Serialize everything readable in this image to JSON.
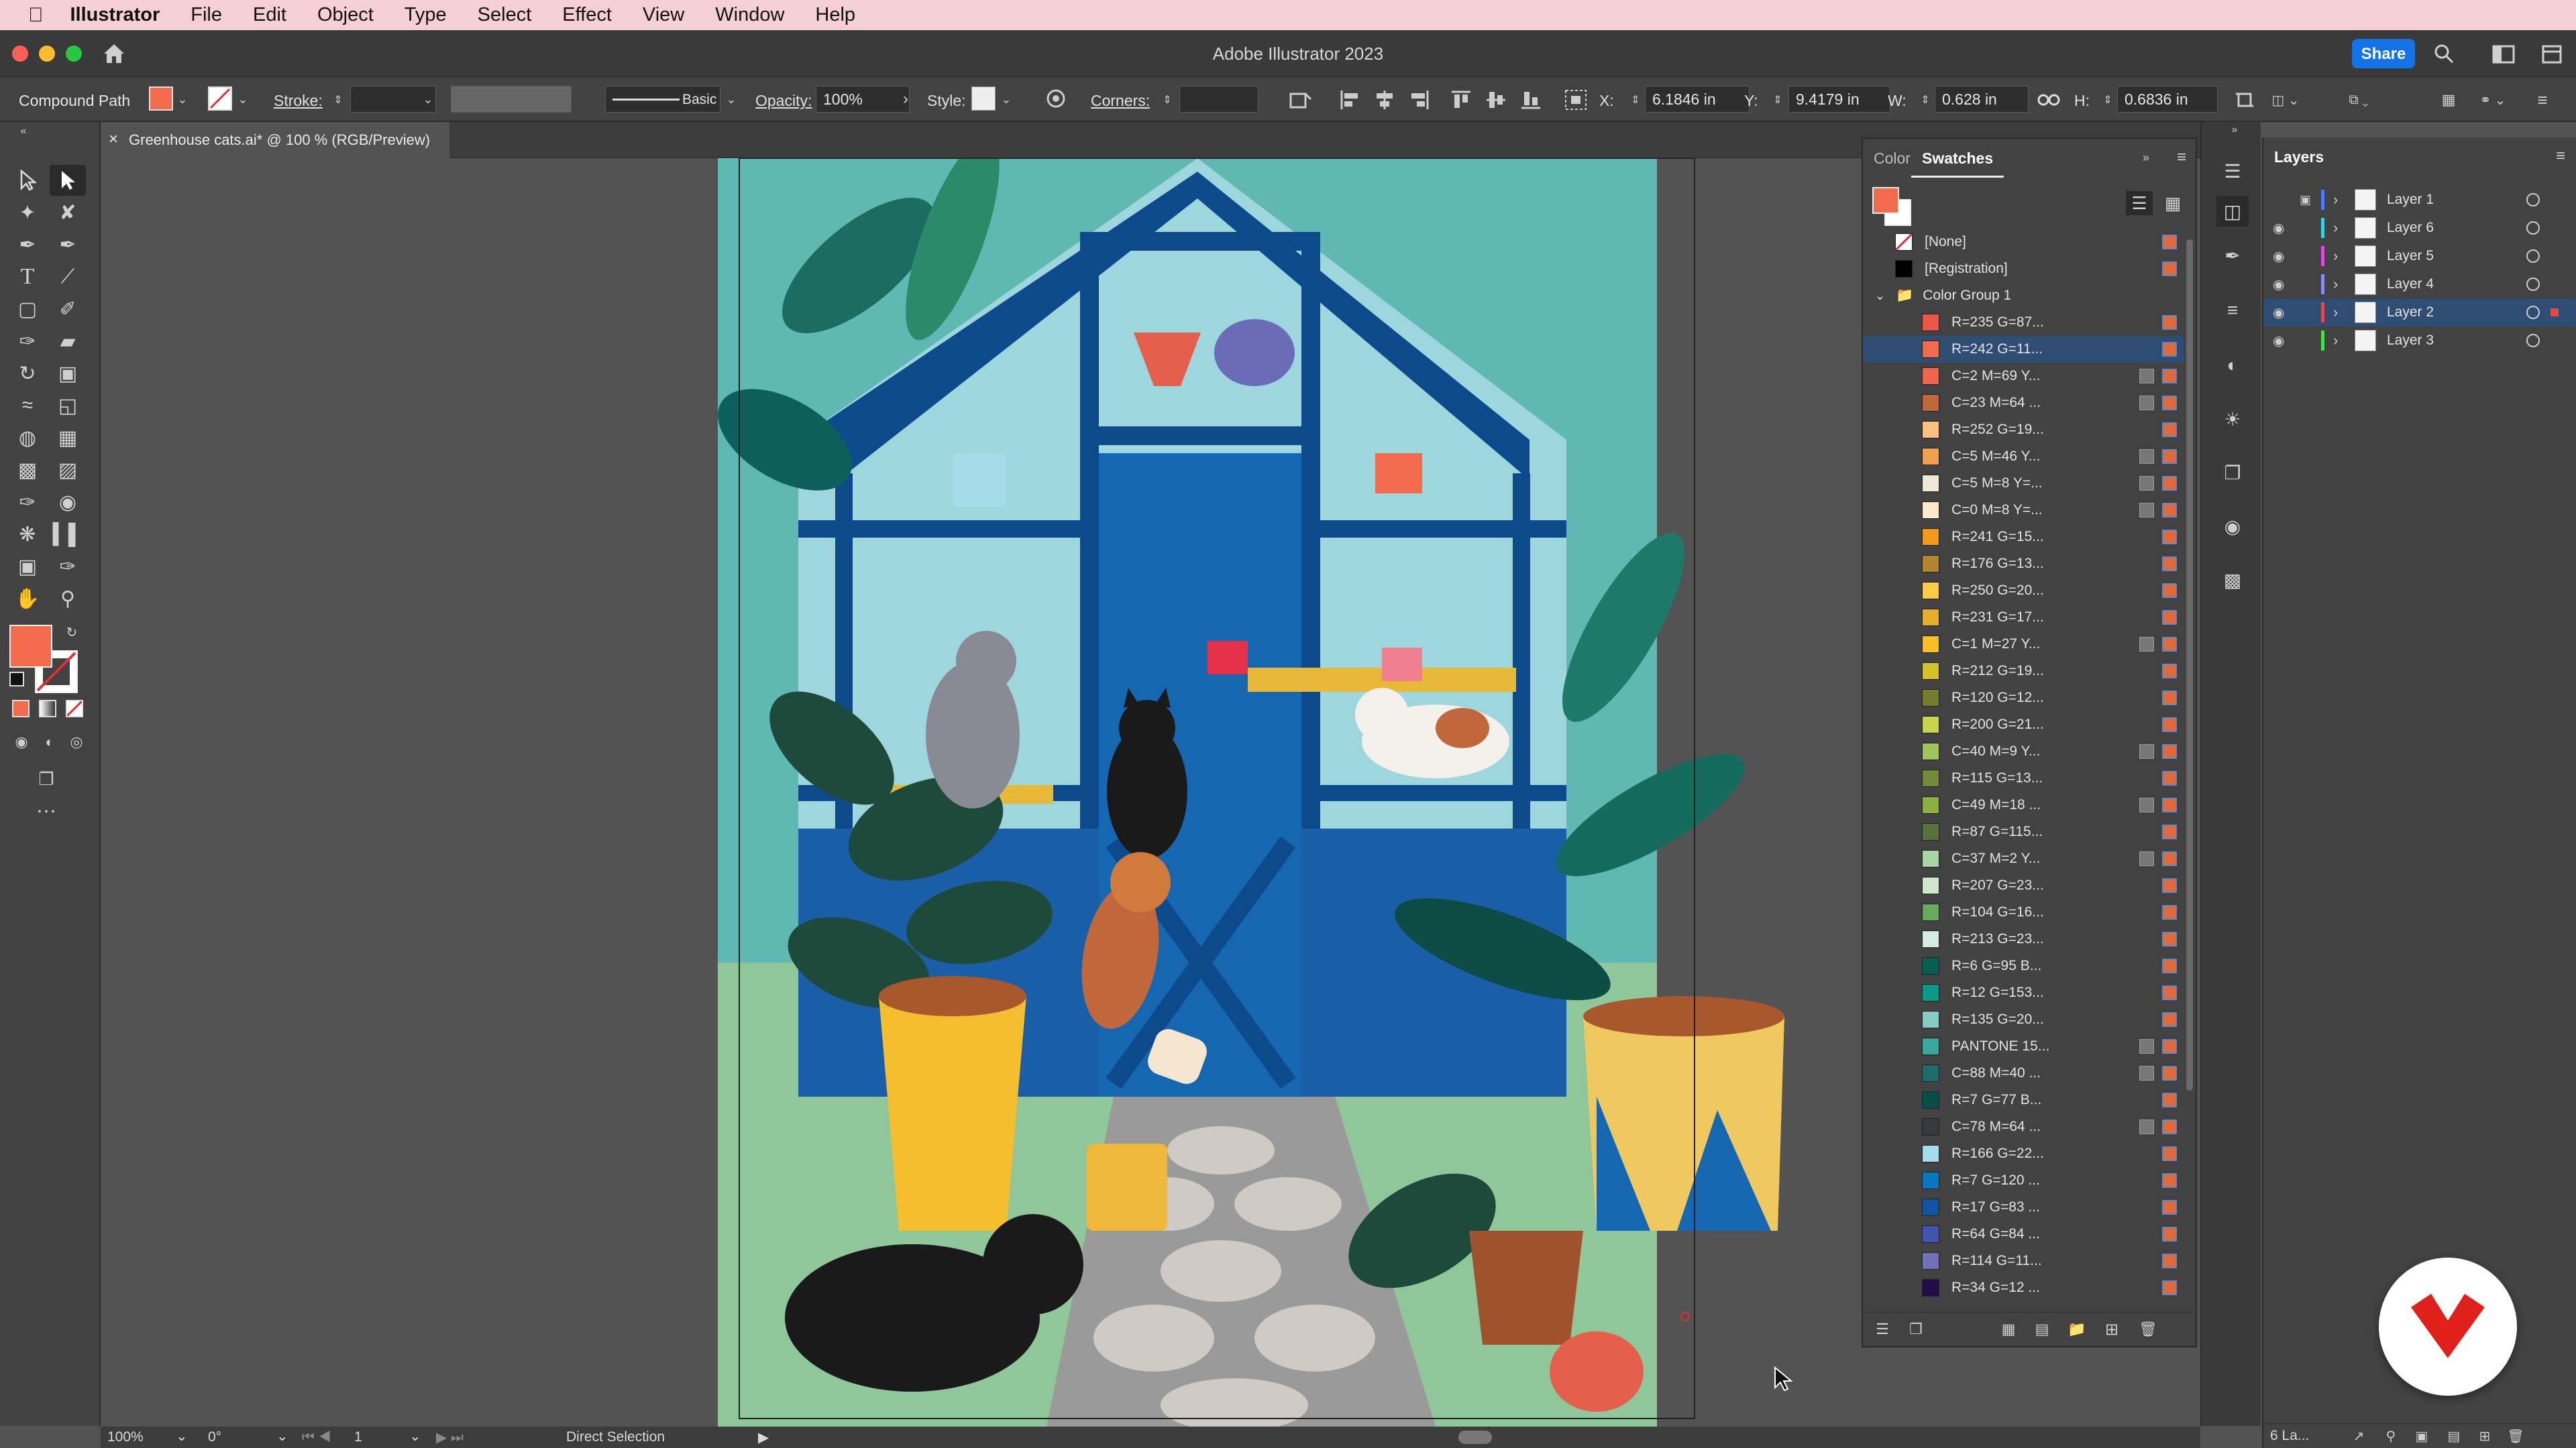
{
  "menubar": {
    "app_name": "Illustrator",
    "items": [
      "File",
      "Edit",
      "Object",
      "Type",
      "Select",
      "Effect",
      "View",
      "Window",
      "Help"
    ]
  },
  "titlebar": {
    "title": "Adobe Illustrator 2023",
    "share_label": "Share"
  },
  "control_bar": {
    "selection_type": "Compound Path",
    "stroke_label": "Stroke:",
    "brush_label": "Basic",
    "opacity_label": "Opacity:",
    "opacity_value": "100%",
    "style_label": "Style:",
    "corners_label": "Corners:",
    "x_label": "X:",
    "x_value": "6.1846 in",
    "y_label": "Y:",
    "y_value": "9.4179 in",
    "w_label": "W:",
    "w_value": "0.628 in",
    "h_label": "H:",
    "h_value": "0.6836 in"
  },
  "document": {
    "tab_title": "Greenhouse cats.ai* @ 100 % (RGB/Preview)"
  },
  "status_bar": {
    "zoom": "100%",
    "rotation": "0°",
    "artboard": "1",
    "tool": "Direct Selection"
  },
  "swatches_panel": {
    "tabs": [
      "Color",
      "Swatches"
    ],
    "active_tab": "Swatches",
    "items": [
      {
        "label": "[None]",
        "color": "none"
      },
      {
        "label": "[Registration]",
        "color": "#000000"
      }
    ],
    "group_label": "Color Group 1",
    "group_items": [
      {
        "label": "R=235 G=87...",
        "color": "#eb574a"
      },
      {
        "label": "R=242 G=11...",
        "color": "#f26b4c",
        "selected": true
      },
      {
        "label": "C=2 M=69 Y...",
        "color": "#f0654b",
        "global": true
      },
      {
        "label": "C=23 M=64 ...",
        "color": "#c0683b",
        "global": true
      },
      {
        "label": "R=252 G=19...",
        "color": "#fcc17f"
      },
      {
        "label": "C=5 M=46 Y...",
        "color": "#f0a050",
        "global": true
      },
      {
        "label": "C=5 M=8 Y=...",
        "color": "#f1e7d5",
        "global": true
      },
      {
        "label": "C=0 M=8 Y=...",
        "color": "#fde8cc",
        "global": true
      },
      {
        "label": "R=241 G=15...",
        "color": "#f19a1b"
      },
      {
        "label": "R=176 G=13...",
        "color": "#b0852b"
      },
      {
        "label": "R=250 G=20...",
        "color": "#facc4a"
      },
      {
        "label": "R=231 G=17...",
        "color": "#e7ae2c"
      },
      {
        "label": "C=1 M=27 Y...",
        "color": "#f7bf26",
        "global": true
      },
      {
        "label": "R=212 G=19...",
        "color": "#d4c22a"
      },
      {
        "label": "R=120 G=12...",
        "color": "#787c2a"
      },
      {
        "label": "R=200 G=21...",
        "color": "#c8d54a"
      },
      {
        "label": "C=40 M=9 Y...",
        "color": "#a0c45c",
        "global": true
      },
      {
        "label": "R=115 G=13...",
        "color": "#738a3a"
      },
      {
        "label": "C=49 M=18 ...",
        "color": "#8ab040",
        "global": true
      },
      {
        "label": "R=87 G=115...",
        "color": "#57733a"
      },
      {
        "label": "C=37 M=2 Y...",
        "color": "#a9d4a8",
        "global": true
      },
      {
        "label": "R=207 G=23...",
        "color": "#cfe8c8"
      },
      {
        "label": "R=104 G=16...",
        "color": "#68a860"
      },
      {
        "label": "R=213 G=23...",
        "color": "#d5ece0"
      },
      {
        "label": "R=6 G=95 B...",
        "color": "#065f50"
      },
      {
        "label": "R=12 G=153...",
        "color": "#0c9988"
      },
      {
        "label": "R=135 G=20...",
        "color": "#87ccc4"
      },
      {
        "label": "PANTONE 15...",
        "color": "#3aa89a",
        "global": true
      },
      {
        "label": "C=88 M=40 ...",
        "color": "#1c6c6a",
        "global": true
      },
      {
        "label": "R=7 G=77 B...",
        "color": "#074d4a"
      },
      {
        "label": "C=78 M=64 ...",
        "color": "#333a40",
        "global": true
      },
      {
        "label": "R=166 G=22...",
        "color": "#a6dcea"
      },
      {
        "label": "R=7 G=120 ...",
        "color": "#0778c0"
      },
      {
        "label": "R=17 G=83 ...",
        "color": "#11539e"
      },
      {
        "label": "R=64 G=84 ...",
        "color": "#4054b0"
      },
      {
        "label": "R=114 G=11...",
        "color": "#7270b8"
      },
      {
        "label": "R=34 G=12 ...",
        "color": "#220c4a"
      }
    ]
  },
  "layers_panel": {
    "title": "Layers",
    "layers": [
      {
        "name": "Layer 1",
        "color": "#4a7cff",
        "visible": false,
        "locked": true,
        "selected": false
      },
      {
        "name": "Layer 6",
        "color": "#3ad0e0",
        "visible": true,
        "locked": false,
        "selected": false
      },
      {
        "name": "Layer 5",
        "color": "#e04ae0",
        "visible": true,
        "locked": false,
        "selected": false
      },
      {
        "name": "Layer 4",
        "color": "#8a8aff",
        "visible": true,
        "locked": false,
        "selected": false
      },
      {
        "name": "Layer 2",
        "color": "#e04a4a",
        "visible": true,
        "locked": false,
        "selected": true
      },
      {
        "name": "Layer 3",
        "color": "#4ae04a",
        "visible": true,
        "locked": false,
        "selected": false
      }
    ],
    "footer_label": "6 La..."
  },
  "colors": {
    "fill": "#f26b4c",
    "accent": "#1473e6",
    "brand_badge": "#e0201a"
  }
}
